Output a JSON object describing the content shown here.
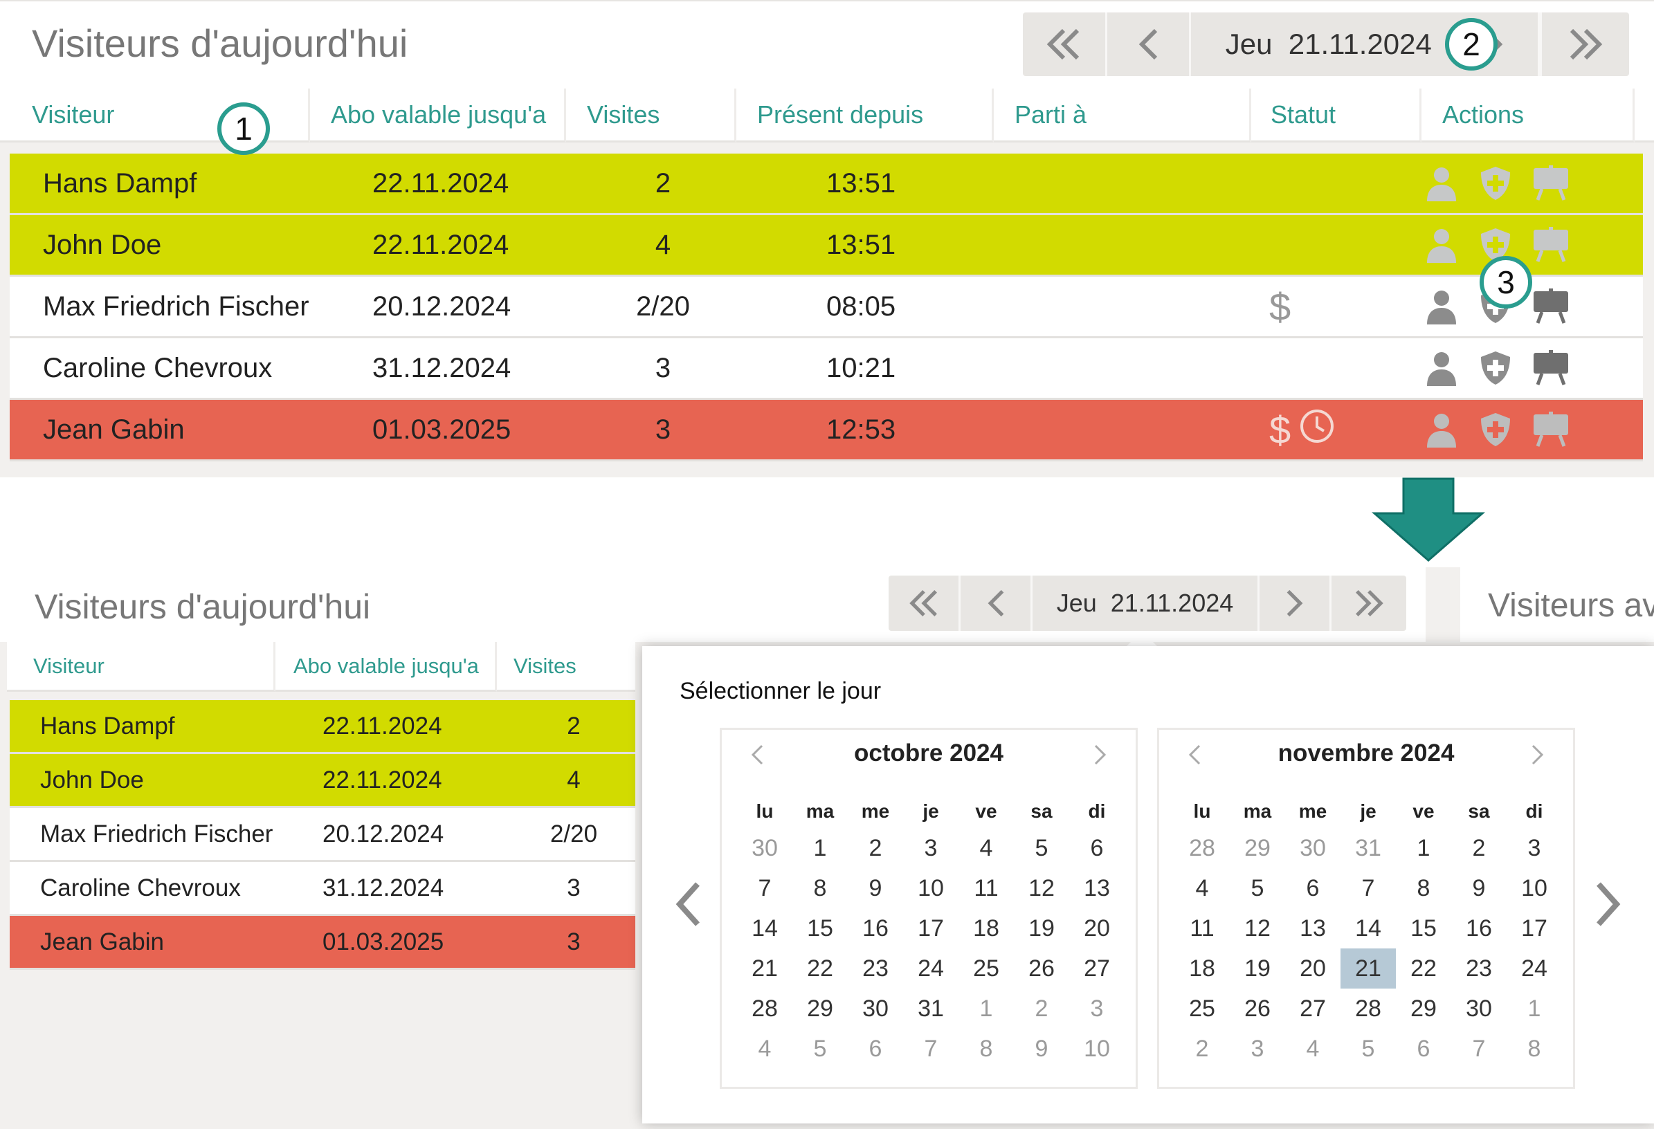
{
  "top": {
    "title": "Visiteurs d'aujourd'hui",
    "date_label": "Jeu  21.11.2024",
    "columns": [
      "Visiteur",
      "Abo valable jusqu'a",
      "Visites",
      "Présent depuis",
      "Parti à",
      "Statut",
      "Actions"
    ],
    "rows": [
      {
        "name": "Hans Dampf",
        "abo": "22.11.2024",
        "visits": "2",
        "present": "13:51",
        "status": "",
        "color": "#d2db00"
      },
      {
        "name": "John Doe",
        "abo": "22.11.2024",
        "visits": "4",
        "present": "13:51",
        "status": "",
        "color": "#d2db00"
      },
      {
        "name": "Max Friedrich Fischer",
        "abo": "20.12.2024",
        "visits": "2/20",
        "present": "08:05",
        "status": "$",
        "color": "#ffffff"
      },
      {
        "name": "Caroline Chevroux",
        "abo": "31.12.2024",
        "visits": "3",
        "present": "10:21",
        "status": "",
        "color": "#ffffff"
      },
      {
        "name": "Jean Gabin",
        "abo": "01.03.2025",
        "visits": "3",
        "present": "12:53",
        "status": "$",
        "color": "#e76452"
      }
    ],
    "annotations": [
      "1",
      "2",
      "3"
    ]
  },
  "bottom": {
    "title": "Visiteurs d'aujourd'hui",
    "side_title": "Visiteurs av",
    "date_label": "Jeu  21.11.2024",
    "columns": [
      "Visiteur",
      "Abo valable jusqu'a",
      "Visites"
    ],
    "rows": [
      {
        "name": "Hans Dampf",
        "abo": "22.11.2024",
        "visits": "2"
      },
      {
        "name": "John Doe",
        "abo": "22.11.2024",
        "visits": "4"
      },
      {
        "name": "Max Friedrich Fischer",
        "abo": "20.12.2024",
        "visits": "2/20"
      },
      {
        "name": "Caroline Chevroux",
        "abo": "31.12.2024",
        "visits": "3"
      },
      {
        "name": "Jean Gabin",
        "abo": "01.03.2025",
        "visits": "3"
      }
    ]
  },
  "calendar": {
    "title": "Sélectionner le jour",
    "weekdays": [
      "lu",
      "ma",
      "me",
      "je",
      "ve",
      "sa",
      "di"
    ],
    "months": [
      {
        "label": "octobre 2024",
        "weeks": [
          [
            "30",
            "1",
            "2",
            "3",
            "4",
            "5",
            "6"
          ],
          [
            "7",
            "8",
            "9",
            "10",
            "11",
            "12",
            "13"
          ],
          [
            "14",
            "15",
            "16",
            "17",
            "18",
            "19",
            "20"
          ],
          [
            "21",
            "22",
            "23",
            "24",
            "25",
            "26",
            "27"
          ],
          [
            "28",
            "29",
            "30",
            "31",
            "1",
            "2",
            "3"
          ],
          [
            "4",
            "5",
            "6",
            "7",
            "8",
            "9",
            "10"
          ]
        ],
        "outside_first_week": 1,
        "outside_from_week5": 4
      },
      {
        "label": "novembre 2024",
        "weeks": [
          [
            "28",
            "29",
            "30",
            "31",
            "1",
            "2",
            "3"
          ],
          [
            "4",
            "5",
            "6",
            "7",
            "8",
            "9",
            "10"
          ],
          [
            "11",
            "12",
            "13",
            "14",
            "15",
            "16",
            "17"
          ],
          [
            "18",
            "19",
            "20",
            "21",
            "22",
            "23",
            "24"
          ],
          [
            "25",
            "26",
            "27",
            "28",
            "29",
            "30",
            "1"
          ],
          [
            "2",
            "3",
            "4",
            "5",
            "6",
            "7",
            "8"
          ]
        ],
        "outside_first_week": 4,
        "outside_from_week5": 6,
        "selected": "21"
      }
    ]
  }
}
